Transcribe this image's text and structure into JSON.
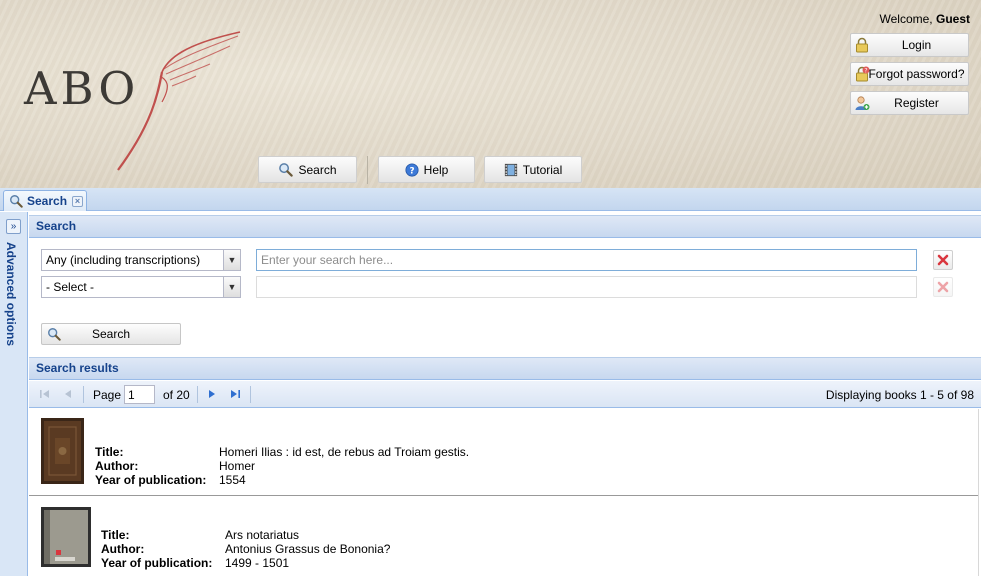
{
  "header": {
    "logo_text": "ABO",
    "welcome_prefix": "Welcome, ",
    "welcome_user": "Guest",
    "login_label": "Login",
    "forgot_label": "Forgot password?",
    "register_label": "Register",
    "nav": {
      "search_label": "Search",
      "help_label": "Help",
      "tutorial_label": "Tutorial"
    }
  },
  "tab": {
    "label": "Search"
  },
  "side_panel": {
    "title": "Advanced options"
  },
  "search_section": {
    "title": "Search",
    "rows": [
      {
        "field": "Any (including transcriptions)",
        "placeholder": "Enter your search here..."
      },
      {
        "field": "- Select -",
        "placeholder": ""
      }
    ],
    "button_label": "Search"
  },
  "results_section": {
    "title": "Search results",
    "pager": {
      "page_label": "Page",
      "current_page": "1",
      "of_label": "of 20",
      "display_text": "Displaying books 1 - 5 of 98"
    },
    "field_labels": {
      "title": "Title:",
      "author": "Author:",
      "year": "Year of publication:"
    },
    "items": [
      {
        "title": "Homeri Ilias : id est, de rebus ad Troiam gestis.",
        "author": "Homer",
        "year": "1554"
      },
      {
        "title": "Ars notariatus",
        "author": "Antonius Grassus de Bononia?",
        "year": "1499 - 1501"
      }
    ]
  },
  "colors": {
    "panel_header_text": "#15428b",
    "panel_border": "#99bbe8",
    "logo_swash": "#c0504d",
    "delete_icon": "#d9363e"
  }
}
